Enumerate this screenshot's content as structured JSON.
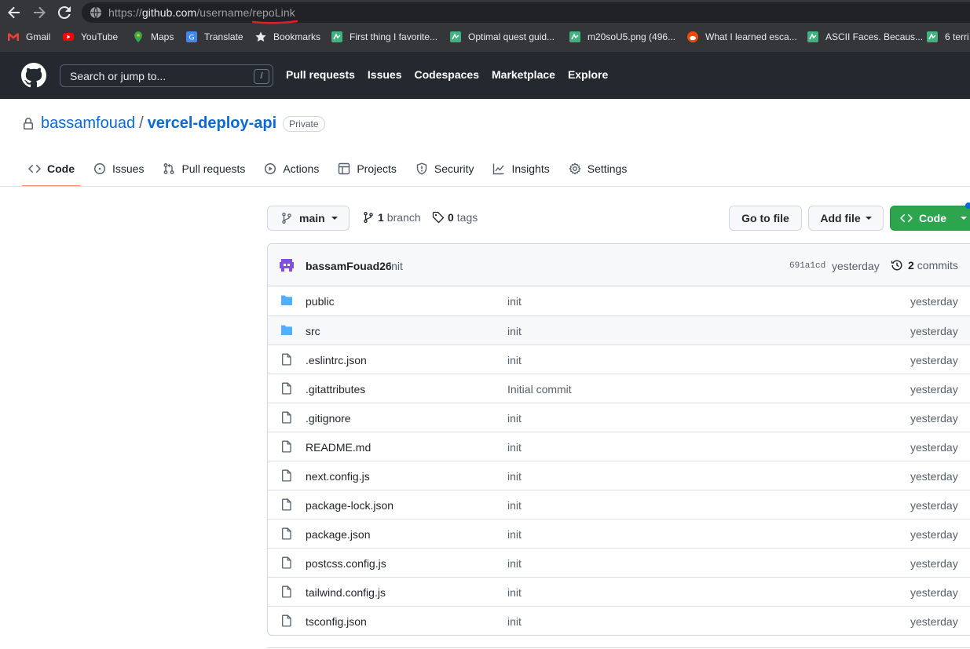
{
  "browser": {
    "url_prefix": "https://",
    "url_host": "github.com",
    "url_path": "/username/repoLink",
    "bookmarks": [
      {
        "label": "Gmail",
        "icon": "gmail-icon"
      },
      {
        "label": "YouTube",
        "icon": "youtube-icon"
      },
      {
        "label": "Maps",
        "icon": "maps-icon"
      },
      {
        "label": "Translate",
        "icon": "translate-icon"
      },
      {
        "label": "Bookmarks",
        "icon": "star-icon"
      },
      {
        "label": "First thing I favorite...",
        "icon": "site-icon"
      },
      {
        "label": "Optimal quest guid...",
        "icon": "site-icon"
      },
      {
        "label": "m20soU5.png (496...",
        "icon": "site-icon"
      },
      {
        "label": "What I learned esca...",
        "icon": "reddit-icon"
      },
      {
        "label": "ASCII Faces. Becaus...",
        "icon": "site-icon"
      },
      {
        "label": "6 terri",
        "icon": "site-icon"
      }
    ]
  },
  "header": {
    "search_placeholder": "Search or jump to...",
    "search_key": "/",
    "nav": [
      "Pull requests",
      "Issues",
      "Codespaces",
      "Marketplace",
      "Explore"
    ]
  },
  "repo": {
    "owner": "bassamfouad",
    "separator": "/",
    "name": "vercel-deploy-api",
    "visibility": "Private",
    "tabs": [
      {
        "label": "Code",
        "icon": "code-icon",
        "active": true
      },
      {
        "label": "Issues",
        "icon": "issue-icon"
      },
      {
        "label": "Pull requests",
        "icon": "pull-request-icon"
      },
      {
        "label": "Actions",
        "icon": "play-icon"
      },
      {
        "label": "Projects",
        "icon": "table-icon"
      },
      {
        "label": "Security",
        "icon": "shield-icon"
      },
      {
        "label": "Insights",
        "icon": "graph-icon"
      },
      {
        "label": "Settings",
        "icon": "gear-icon"
      }
    ]
  },
  "toolbar": {
    "branch": "main",
    "branch_count": "1",
    "branch_word": "branch",
    "tag_count": "0",
    "tag_word": "tags",
    "goto_file": "Go to file",
    "add_file": "Add file",
    "code": "Code"
  },
  "commit": {
    "author": "bassamFouad26",
    "message": "init",
    "sha": "691a1cd",
    "time": "yesterday",
    "commit_count": "2",
    "commit_word": "commits"
  },
  "files": [
    {
      "name": "public",
      "type": "dir",
      "message": "init",
      "age": "yesterday"
    },
    {
      "name": "src",
      "type": "dir",
      "message": "init",
      "age": "yesterday"
    },
    {
      "name": ".eslintrc.json",
      "type": "file",
      "message": "init",
      "age": "yesterday"
    },
    {
      "name": ".gitattributes",
      "type": "file",
      "message": "Initial commit",
      "age": "yesterday"
    },
    {
      "name": ".gitignore",
      "type": "file",
      "message": "init",
      "age": "yesterday"
    },
    {
      "name": "README.md",
      "type": "file",
      "message": "init",
      "age": "yesterday"
    },
    {
      "name": "next.config.js",
      "type": "file",
      "message": "init",
      "age": "yesterday"
    },
    {
      "name": "package-lock.json",
      "type": "file",
      "message": "init",
      "age": "yesterday"
    },
    {
      "name": "package.json",
      "type": "file",
      "message": "init",
      "age": "yesterday"
    },
    {
      "name": "postcss.config.js",
      "type": "file",
      "message": "init",
      "age": "yesterday"
    },
    {
      "name": "tailwind.config.js",
      "type": "file",
      "message": "init",
      "age": "yesterday"
    },
    {
      "name": "tsconfig.json",
      "type": "file",
      "message": "init",
      "age": "yesterday"
    }
  ],
  "colors": {
    "link": "#0969da",
    "primary_button": "#2da44e",
    "header_bg": "#24292f",
    "active_tab_underline": "#fd8c73",
    "folder": "#54aeff",
    "annotation_underline": "#e02020"
  }
}
